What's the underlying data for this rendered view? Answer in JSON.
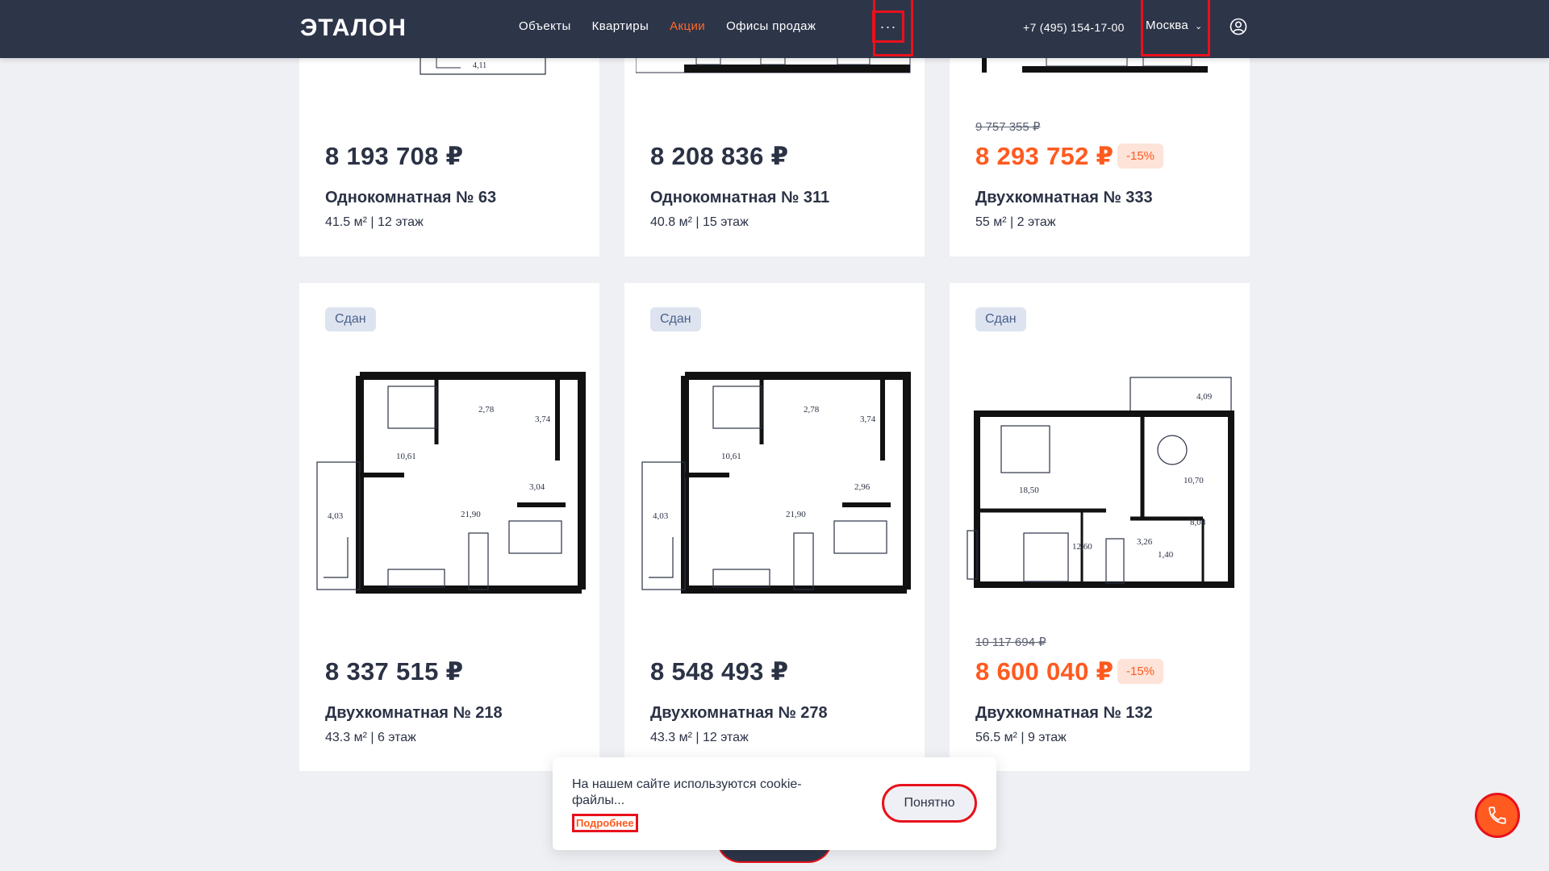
{
  "header": {
    "logo": "ЭТАЛОН",
    "nav": [
      {
        "label": "Объекты"
      },
      {
        "label": "Квартиры"
      },
      {
        "label": "Акции"
      },
      {
        "label": "Офисы продаж"
      }
    ],
    "more_label": "···",
    "phone": "+7 (495) 154-17-00",
    "city": "Москва",
    "city_chevron": "⌄"
  },
  "cards_top": [
    {
      "price": "8 193 708 ₽",
      "title": "Однокомнатная № 63",
      "meta": "41.5 м² | 12 этаж",
      "plan_label": "4,11"
    },
    {
      "price": "8 208 836 ₽",
      "title": "Однокомнатная № 311",
      "meta": "40.8 м² | 15 этаж"
    },
    {
      "old_price": "9 757 355 ₽",
      "price": "8 293 752 ₽",
      "discount": "-15%",
      "title": "Двухкомнатная № 333",
      "meta": "55 м² | 2 этаж"
    }
  ],
  "cards_bottom": [
    {
      "tag": "Сдан",
      "price": "8 337 515 ₽",
      "title": "Двухкомнатная № 218",
      "meta": "43.3 м² | 6 этаж",
      "plan": {
        "r1": "10,61",
        "r2": "2,78",
        "r3": "3,74",
        "r4": "3,04",
        "r5": "4,03",
        "r6": "21,90"
      }
    },
    {
      "tag": "Сдан",
      "price": "8 548 493 ₽",
      "title": "Двухкомнатная № 278",
      "meta": "43.3 м² | 12 этаж",
      "plan": {
        "r1": "10,61",
        "r2": "2,78",
        "r3": "3,74",
        "r4": "2,96",
        "r5": "4,03",
        "r6": "21,90"
      }
    },
    {
      "tag": "Сдан",
      "old_price": "10 117 694 ₽",
      "price": "8 600 040 ₽",
      "discount": "-15%",
      "title": "Двухкомнатная № 132",
      "meta": "56.5 м² | 9 этаж",
      "plan": {
        "r1": "4,09",
        "r2": "18,50",
        "r3": "10,70",
        "r4": "12,60",
        "r5": "3,26",
        "r6": "8,08",
        "r7": "1,40"
      }
    }
  ],
  "cookie": {
    "text": "На нашем сайте используются cookie-файлы...",
    "link": "Подробнее",
    "button": "Понятно"
  },
  "colors": {
    "header": "#2d3549",
    "accent": "#ff5a1f",
    "highlight": "#e8111b"
  },
  "icons": {
    "user": "user-circle-icon",
    "call": "phone-icon",
    "more": "ellipsis-icon"
  }
}
